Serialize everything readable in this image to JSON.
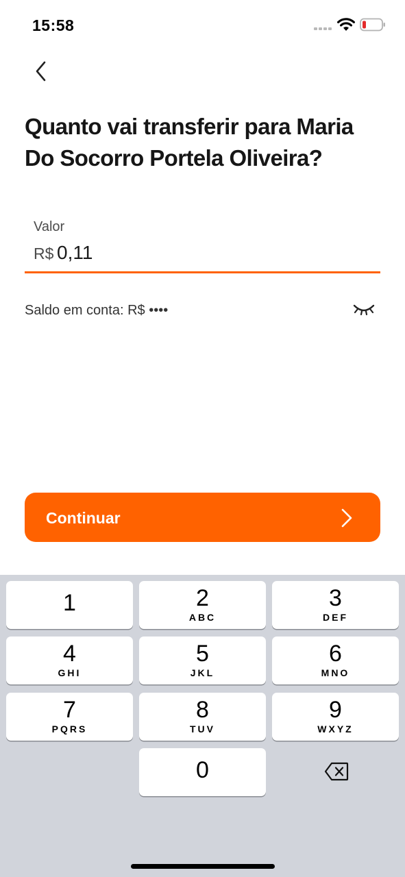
{
  "status_bar": {
    "time": "15:58",
    "icons": [
      "signal-dots-icon",
      "wifi-icon",
      "battery-low-icon"
    ],
    "battery_color": "#e32b2b"
  },
  "header": {
    "back_icon": "chevron-left-icon",
    "title": "Quanto vai transferir para Maria Do Socorro Portela Oliveira?"
  },
  "amount_input": {
    "label": "Valor",
    "currency": "R$",
    "value": "0,11"
  },
  "balance": {
    "text": "Saldo em conta: R$ ••••",
    "toggle_icon": "eye-closed-icon"
  },
  "continue_button": {
    "label": "Continuar",
    "icon": "chevron-right-icon"
  },
  "keypad": {
    "keys": [
      {
        "digit": "1",
        "letters": ""
      },
      {
        "digit": "2",
        "letters": "ABC"
      },
      {
        "digit": "3",
        "letters": "DEF"
      },
      {
        "digit": "4",
        "letters": "GHI"
      },
      {
        "digit": "5",
        "letters": "JKL"
      },
      {
        "digit": "6",
        "letters": "MNO"
      },
      {
        "digit": "7",
        "letters": "PQRS"
      },
      {
        "digit": "8",
        "letters": "TUV"
      },
      {
        "digit": "9",
        "letters": "WXYZ"
      },
      {
        "digit": "0",
        "letters": ""
      }
    ],
    "delete_icon": "backspace-icon"
  },
  "colors": {
    "accent": "#ff6200",
    "keyboard_bg": "#d1d4db"
  }
}
